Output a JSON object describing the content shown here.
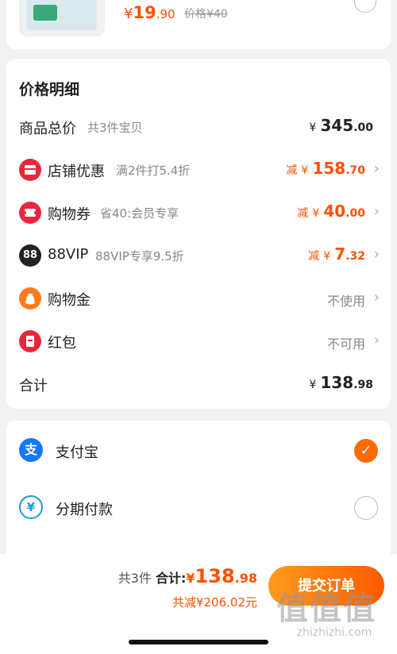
{
  "product": {
    "price_currency": "¥",
    "price_int": "19",
    "price_dec": ".90",
    "original_price": "价格¥40"
  },
  "detail": {
    "title": "价格明细",
    "rows": [
      {
        "name": "商品总价",
        "desc": "共3件宝贝",
        "minus": "",
        "currency": "¥",
        "int": "345",
        "dec": ".00"
      },
      {
        "name": "店铺优惠",
        "desc": "满2件打5.4折",
        "minus": "减",
        "currency": "¥",
        "int": "158",
        "dec": ".70",
        "icon": "store-coupon-icon",
        "icon_color": "#e8273c"
      },
      {
        "name": "购物券",
        "desc": "省40:会员专享",
        "minus": "减",
        "currency": "¥",
        "int": "40",
        "dec": ".00",
        "icon": "ticket-icon",
        "icon_color": "#e8273c"
      },
      {
        "name": "88VIP",
        "desc": "88VIP专享9.5折",
        "minus": "减",
        "currency": "¥",
        "int": "7",
        "dec": ".32",
        "icon": "88vip-icon",
        "icon_color": "#222222",
        "icon_text": "88"
      },
      {
        "name": "购物金",
        "status": "不使用",
        "icon": "gold-bag-icon",
        "icon_color": "#ff7a1a"
      },
      {
        "name": "红包",
        "status": "不可用",
        "icon": "red-envelope-icon",
        "icon_color": "#e8273c"
      },
      {
        "name": "合计",
        "currency": "¥",
        "int": "138",
        "dec": ".98"
      }
    ]
  },
  "payment": {
    "options": [
      {
        "name": "支付宝",
        "icon": "alipay-icon",
        "icon_text": "支",
        "selected": true
      },
      {
        "name": "分期付款",
        "icon": "installment-icon",
        "icon_text": "¥",
        "selected": false
      }
    ]
  },
  "bottom": {
    "count": "共3件",
    "total_label": "合计:",
    "currency": "¥",
    "total_int": "138",
    "total_dec": ".98",
    "saved": "共减¥206.02元",
    "submit_label": "提交订单"
  },
  "watermark": {
    "glyphs": "值值值",
    "site": "zhizhizhi.com"
  },
  "colors": {
    "accent": "#ff5000",
    "alipay": "#1677ff",
    "check": "#ff6a0a"
  }
}
